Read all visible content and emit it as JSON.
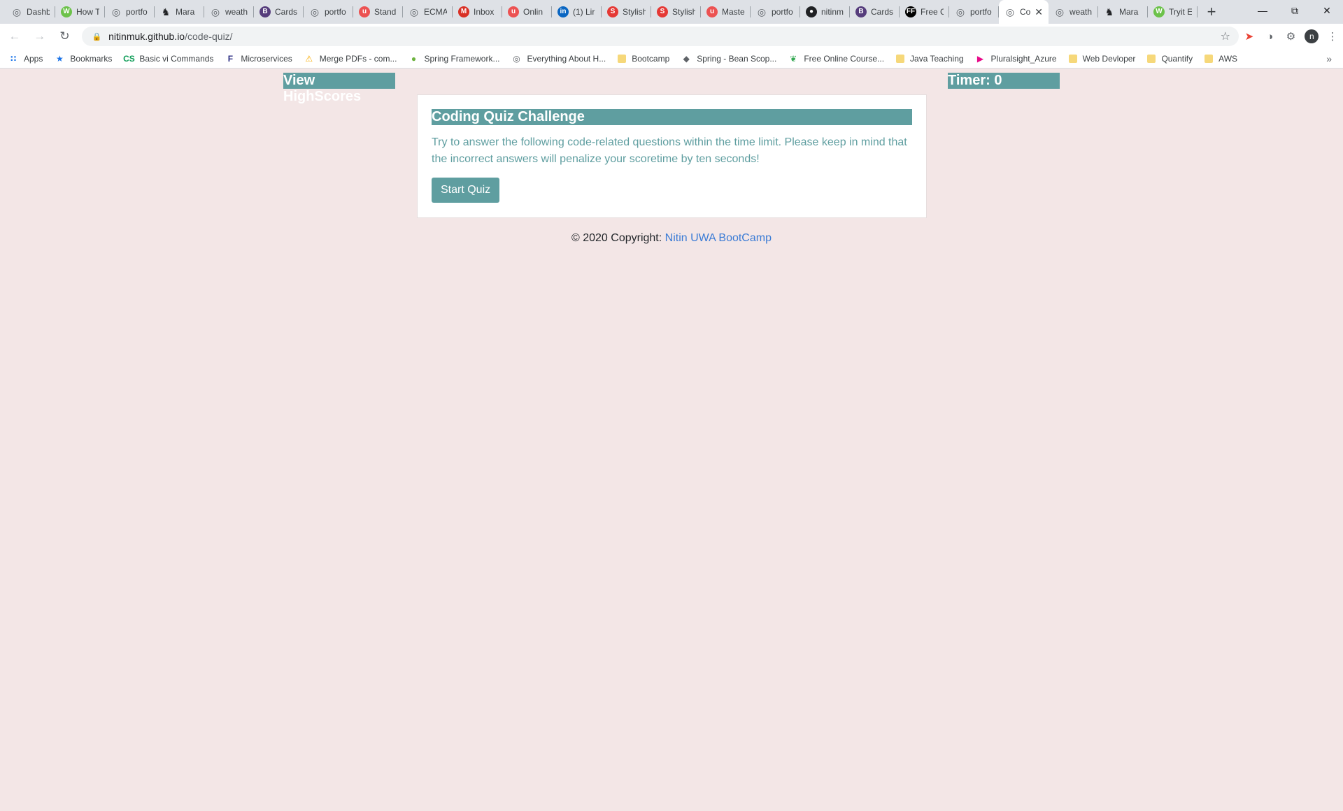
{
  "browser": {
    "tabs": [
      {
        "title": "Dashb",
        "icon": "globe-icon",
        "color": "#5f6368"
      },
      {
        "title": "How T",
        "icon": "ws-icon",
        "color": "#6cc24a"
      },
      {
        "title": "portfo",
        "icon": "globe-icon",
        "color": "#5f6368"
      },
      {
        "title": "Mara",
        "icon": "horse-icon",
        "color": "#202124"
      },
      {
        "title": "weath",
        "icon": "globe-icon",
        "color": "#5f6368"
      },
      {
        "title": "Cards",
        "icon": "bootstrap-icon",
        "color": "#563d7c"
      },
      {
        "title": "portfo",
        "icon": "globe-icon",
        "color": "#5f6368"
      },
      {
        "title": "Stand",
        "icon": "udemy-icon",
        "color": "#ec5252"
      },
      {
        "title": "ECMA",
        "icon": "globe-icon",
        "color": "#5f6368"
      },
      {
        "title": "Inbox",
        "icon": "gmail-icon",
        "color": "#d93025"
      },
      {
        "title": "Onlin",
        "icon": "udemy-icon",
        "color": "#ec5252"
      },
      {
        "title": "(1) Lir",
        "icon": "linkedin-icon",
        "color": "#0a66c2"
      },
      {
        "title": "Stylish",
        "icon": "s-icon",
        "color": "#e53935"
      },
      {
        "title": "Stylish",
        "icon": "s-icon",
        "color": "#e53935"
      },
      {
        "title": "Maste",
        "icon": "udemy-icon",
        "color": "#ec5252"
      },
      {
        "title": "portfo",
        "icon": "globe-icon",
        "color": "#5f6368"
      },
      {
        "title": "nitinm",
        "icon": "github-icon",
        "color": "#202124"
      },
      {
        "title": "Cards",
        "icon": "bootstrap-icon",
        "color": "#563d7c"
      },
      {
        "title": "Free C",
        "icon": "ff-icon",
        "color": "#000000"
      },
      {
        "title": "portfo",
        "icon": "globe-icon",
        "color": "#5f6368"
      },
      {
        "title": "Co",
        "icon": "globe-icon",
        "color": "#5f6368",
        "active": true
      },
      {
        "title": "weath",
        "icon": "globe-icon",
        "color": "#5f6368"
      },
      {
        "title": "Mara",
        "icon": "horse-icon",
        "color": "#202124"
      },
      {
        "title": "Tryit E",
        "icon": "ws-icon",
        "color": "#6cc24a"
      }
    ],
    "new_tab": "+",
    "url_host": "nitinmuk.github.io",
    "url_path": "/code-quiz/",
    "avatar_letter": "n",
    "bookmarks": [
      {
        "label": "Apps",
        "icon": "apps-icon",
        "color": "#1a73e8"
      },
      {
        "label": "Bookmarks",
        "icon": "star-icon",
        "color": "#1a73e8"
      },
      {
        "label": "Basic vi Commands",
        "icon": "cs-icon",
        "color": "#0f9d58"
      },
      {
        "label": "Microservices",
        "icon": "f-icon",
        "color": "#2c2e83"
      },
      {
        "label": "Merge PDFs - com...",
        "icon": "warning-icon",
        "color": "#f9ab00"
      },
      {
        "label": "Spring Framework...",
        "icon": "spring-icon",
        "color": "#6db33f"
      },
      {
        "label": "Everything About H...",
        "icon": "globe-icon",
        "color": "#5f6368"
      },
      {
        "label": "Bootcamp",
        "icon": "folder-icon",
        "color": "#f6d87a"
      },
      {
        "label": "Spring - Bean Scop...",
        "icon": "diamond-icon",
        "color": "#5f6368"
      },
      {
        "label": "Free Online Course...",
        "icon": "leaf-icon",
        "color": "#34a853"
      },
      {
        "label": "Java Teaching",
        "icon": "folder-icon",
        "color": "#f6d87a"
      },
      {
        "label": "Pluralsight_Azure",
        "icon": "pluralsight-icon",
        "color": "#e80a89"
      },
      {
        "label": "Web Devloper",
        "icon": "folder-icon",
        "color": "#f6d87a"
      },
      {
        "label": "Quantify",
        "icon": "folder-icon",
        "color": "#f6d87a"
      },
      {
        "label": "AWS",
        "icon": "folder-icon",
        "color": "#f6d87a"
      }
    ]
  },
  "page": {
    "highscores_label": "View HighScores",
    "timer_label": "Timer: 0",
    "card_title": "Coding Quiz Challenge",
    "card_text": "Try to answer the following code-related questions within the time limit. Please keep in mind that the incorrect answers will penalize your scoretime by ten seconds!",
    "start_button": "Start Quiz",
    "footer_prefix": "© 2020 Copyright: ",
    "footer_link": "Nitin UWA BootCamp"
  },
  "colors": {
    "accent": "#5f9ea0",
    "background": "#f3e6e6",
    "link": "#3a7bd5"
  }
}
